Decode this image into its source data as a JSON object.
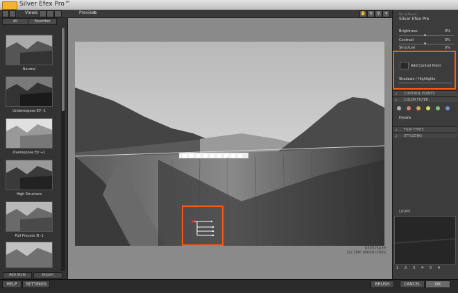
{
  "window": {
    "title": "Silver Efex Pro™"
  },
  "toolbar": {
    "views_label": "Views:",
    "preview_label": "Preview:",
    "icons": [
      "hand-icon",
      "zoom-icon",
      "zoom-fit-icon",
      "background-icon"
    ]
  },
  "left_panel": {
    "tabs": [
      "All",
      "Favorites"
    ],
    "presets": [
      "Neutral",
      "Underexpose EV -1",
      "Overexpose EV +1",
      "High Structure",
      "Pull Process N -1",
      ""
    ],
    "add_style": "Add Style",
    "import": "Import"
  },
  "image": {
    "filename": "D3D5754.tif",
    "info": "(12.2MP, NIKON D300)"
  },
  "right_panel": {
    "vendor": "Nik Software",
    "product": "Silver Efex Pro",
    "sliders": [
      {
        "label": "Brightness",
        "value": "0%"
      },
      {
        "label": "Contrast",
        "value": "0%"
      },
      {
        "label": "Structure",
        "value": "0%"
      }
    ],
    "add_control_point": "Add Control Point",
    "shadows_highlights": "Shadows / Highlights",
    "sections": [
      {
        "name": "CONTROL POINTS"
      },
      {
        "name": "COLOR FILTER"
      },
      {
        "name": "FILM TYPES"
      },
      {
        "name": "STYLIZING"
      }
    ],
    "details_label": "Details",
    "filter_colors": [
      "#b0b0b0",
      "#e08070",
      "#e0a050",
      "#d8d860",
      "#80c070",
      "#7090d0"
    ],
    "loupe_label": "LOUPE",
    "loupe_pages": [
      "1",
      "2",
      "3",
      "4",
      "5",
      "6"
    ]
  },
  "bottom_bar": {
    "help": "HELP",
    "settings": "SETTINGS",
    "brush": "BRUSH",
    "cancel": "CANCEL",
    "ok": "OK"
  },
  "colors": {
    "highlight": "#ff5a14"
  }
}
